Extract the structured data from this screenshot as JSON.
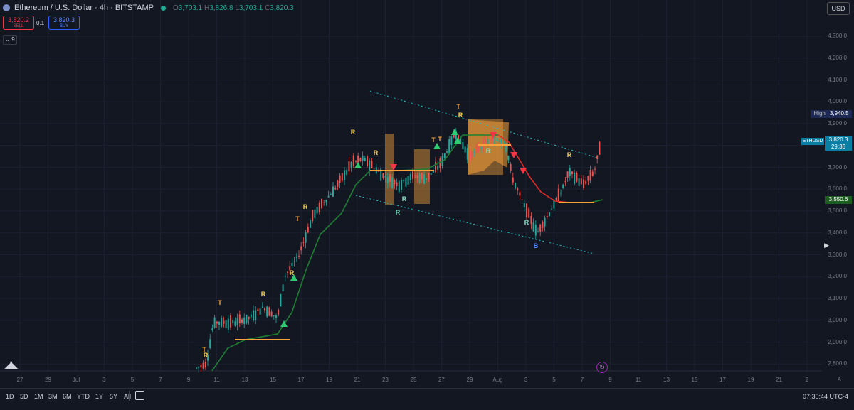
{
  "header": {
    "title": "Ethereum / U.S. Dollar · 4h · BITSTAMP",
    "open_label": "O",
    "open": "3,703.1",
    "high_label": "H",
    "high": "3,826.8",
    "low_label": "L",
    "low": "3,703.1",
    "close_label": "C",
    "close": "3,820.3",
    "currency": "USD"
  },
  "trade": {
    "sell_price": "3,820.2",
    "sell_label": "SELL",
    "quantity": "0.1",
    "buy_price": "3,820.3",
    "buy_label": "BUY",
    "indicators_count": "9"
  },
  "price_axis": [
    "4,300.0",
    "4,200.0",
    "4,100.0",
    "4,000.0",
    "3,900.0",
    "3,800.0",
    "3,700.0",
    "3,600.0",
    "3,500.0",
    "3,400.0",
    "3,300.0",
    "3,200.0",
    "3,100.0",
    "3,000.0",
    "2,900.0",
    "2,800.0"
  ],
  "time_axis": [
    "27",
    "29",
    "Jul",
    "3",
    "5",
    "7",
    "9",
    "11",
    "13",
    "15",
    "17",
    "19",
    "21",
    "23",
    "25",
    "27",
    "29",
    "Aug",
    "3",
    "5",
    "7",
    "9",
    "11",
    "13",
    "15",
    "17",
    "19",
    "21",
    "2"
  ],
  "tags": {
    "high_label": "High",
    "high_value": "3,940.5",
    "symbol": "ETHUSD",
    "last_price": "3,820.3",
    "countdown": "29:36",
    "support": "3,550.6"
  },
  "signal_labels": [
    {
      "text": "T",
      "color": "#f7a23b"
    },
    {
      "text": "R",
      "color": "#f7d358"
    },
    {
      "text": "T",
      "color": "#f7a23b"
    },
    {
      "text": "R",
      "color": "#f7d358"
    },
    {
      "text": "R",
      "color": "#f7d358"
    },
    {
      "text": "T",
      "color": "#f7a23b"
    },
    {
      "text": "R",
      "color": "#f7d358"
    },
    {
      "text": "R",
      "color": "#f7d358"
    },
    {
      "text": "R",
      "color": "#f7d358"
    },
    {
      "text": "R",
      "color": "#7ee8c8"
    },
    {
      "text": "R",
      "color": "#7ee8c8"
    },
    {
      "text": "T",
      "color": "#f7a23b"
    },
    {
      "text": "T",
      "color": "#f7a23b"
    },
    {
      "text": "T",
      "color": "#f7a23b"
    },
    {
      "text": "R",
      "color": "#f7d358"
    },
    {
      "text": "R",
      "color": "#7ee8c8"
    },
    {
      "text": "R",
      "color": "#7ee8c8"
    },
    {
      "text": "B",
      "color": "#5b8cff"
    },
    {
      "text": "R",
      "color": "#f7d358"
    }
  ],
  "timeframes": [
    "1D",
    "5D",
    "1M",
    "3M",
    "6M",
    "YTD",
    "1Y",
    "5Y",
    "All"
  ],
  "clock": "07:30:44 UTC-4",
  "chart_data": {
    "type": "candlestick",
    "symbol": "ETHUSD",
    "interval": "4h",
    "ylim": [
      2760,
      4400
    ],
    "x": [
      "Jul 9",
      "Jul 11",
      "Jul 13",
      "Jul 15",
      "Jul 17",
      "Jul 19",
      "Jul 21",
      "Jul 23",
      "Jul 25",
      "Jul 27",
      "Jul 29",
      "Jul 31",
      "Aug 2",
      "Aug 3",
      "Aug 5",
      "Aug 7"
    ],
    "close": [
      2780,
      3000,
      3010,
      3180,
      3450,
      3620,
      3720,
      3640,
      3650,
      3860,
      3700,
      3520,
      3420,
      3500,
      3650,
      3820
    ],
    "trend_line": [
      2780,
      2850,
      2900,
      3000,
      3300,
      3550,
      3700,
      3720,
      3730,
      3820,
      3800,
      3700,
      3560,
      3530,
      3540,
      3550
    ],
    "support_levels": [
      2900,
      3680,
      3800,
      3550
    ],
    "channel_upper": [
      [
        4050,
        3740
      ]
    ],
    "channel_lower": [
      [
        3600,
        3300
      ]
    ]
  },
  "colors": {
    "up": "#26a69a",
    "down": "#ef5350",
    "trend_up": "#1e7e34",
    "trend_down": "#e52a2a",
    "level": "#f7a23b",
    "channel": "#22c1c3"
  }
}
